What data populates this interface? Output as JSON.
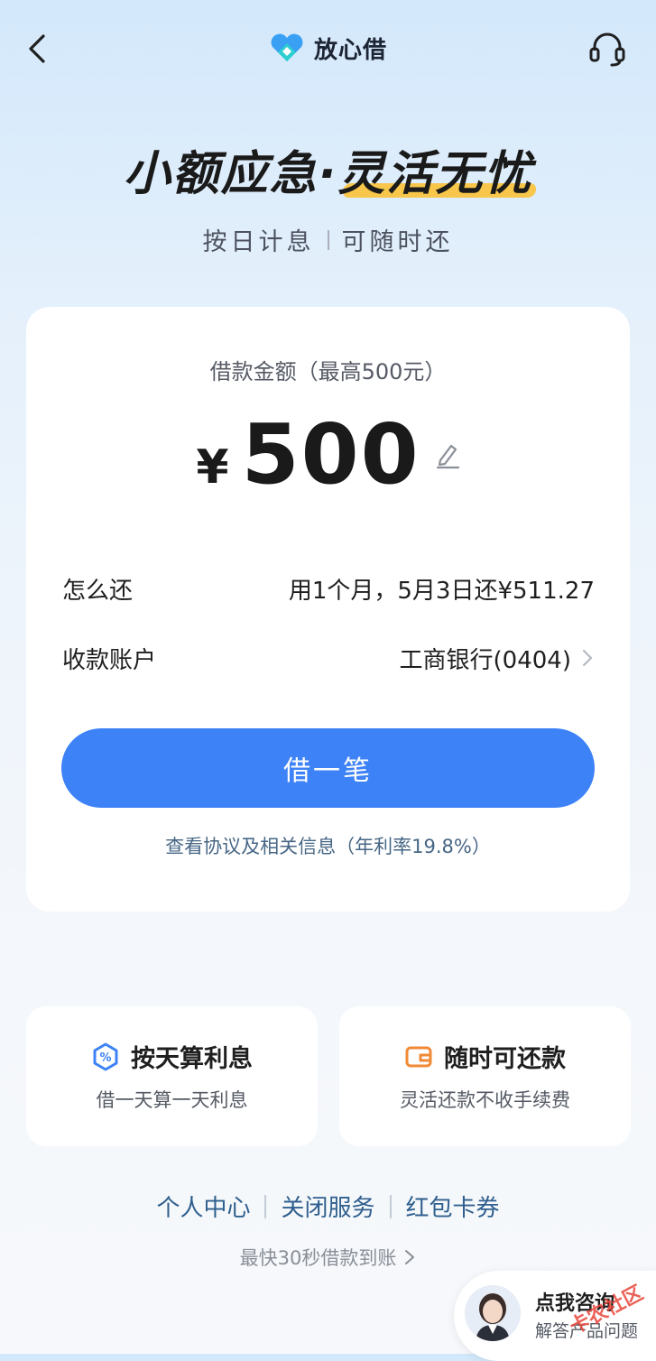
{
  "header": {
    "brand": "放心借"
  },
  "hero": {
    "title_part1": "小额应急·",
    "title_part2": "灵活无忧",
    "sub_left": "按日计息",
    "sub_right": "可随时还"
  },
  "loan_card": {
    "amount_label": "借款金额（最高500元）",
    "currency": "¥",
    "amount": "500",
    "repay_label": "怎么还",
    "repay_value": "用1个月，5月3日还¥511.27",
    "account_label": "收款账户",
    "account_value": "工商银行(0404)",
    "button": "借一笔",
    "agreement": "查看协议及相关信息（年利率19.8%）"
  },
  "features": [
    {
      "title": "按天算利息",
      "desc": "借一天算一天利息",
      "icon": "percent-shield-icon",
      "color": "#3d82f6"
    },
    {
      "title": "随时可还款",
      "desc": "灵活还款不收手续费",
      "icon": "wallet-icon",
      "color": "#f08a36"
    }
  ],
  "links": [
    "个人中心",
    "关闭服务",
    "红包卡券"
  ],
  "tagline": "最快30秒借款到账",
  "consult": {
    "title": "点我咨询",
    "subtitle": "解答产品问题"
  },
  "watermark": {
    "text": "卡农社区"
  },
  "colors": {
    "primary": "#3d82f6",
    "highlight": "#f7c64a",
    "link": "#2f5f8e"
  }
}
